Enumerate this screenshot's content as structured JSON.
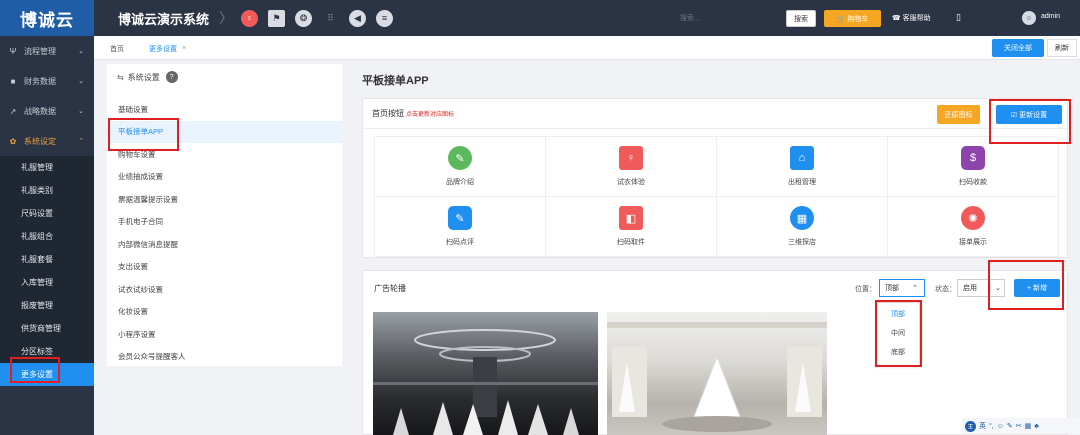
{
  "logo": "博诚云",
  "header": {
    "title": "博诚云演示系统",
    "search_placeholder": "搜索...",
    "search_button": "搜索",
    "cart_button": "购物车",
    "help": "客服帮助",
    "username": "admin"
  },
  "sidebar": {
    "items": [
      {
        "label": "流程管理",
        "icon": "flow-icon"
      },
      {
        "label": "财务数据",
        "icon": "briefcase-icon"
      },
      {
        "label": "战略数据",
        "icon": "trend-icon"
      },
      {
        "label": "系统设定",
        "icon": "gear-icon"
      }
    ],
    "subitems": [
      "礼服管理",
      "礼服类别",
      "尺码设置",
      "礼服组合",
      "礼服套餐",
      "入库管理",
      "报废管理",
      "供货商管理",
      "分区标签",
      "更多设置"
    ]
  },
  "tabs": {
    "home": "首页",
    "more": "更多设置",
    "close_all": "关闭全部",
    "refresh": "刷新"
  },
  "settings": {
    "title": "系统设置",
    "items": [
      "基础设置",
      "平板接单APP",
      "购物车设置",
      "业绩抽成设置",
      "票据温馨提示设置",
      "手机电子合同",
      "内部微信消息提醒",
      "支出设置",
      "试衣试纱设置",
      "化妆设置",
      "小程序设置",
      "会员公众号提醒客人"
    ]
  },
  "main": {
    "title": "平板接单APP",
    "home_buttons": {
      "title": "首页按钮",
      "hint": "点击更新对应图标",
      "restore": "还原图标",
      "update": "更新设置",
      "items": [
        {
          "label": "品牌介绍",
          "color": "#5cb85c",
          "icon": "tag-icon"
        },
        {
          "label": "试衣体验",
          "color": "#f05a5a",
          "icon": "dress-icon"
        },
        {
          "label": "出租管理",
          "color": "#1f8ff0",
          "icon": "shop-icon"
        },
        {
          "label": "扫码收款",
          "color": "#8e44ad",
          "icon": "money-icon"
        },
        {
          "label": "扫码点评",
          "color": "#1f8ff0",
          "icon": "edit-icon"
        },
        {
          "label": "扫码取件",
          "color": "#f05a5a",
          "icon": "bag-icon"
        },
        {
          "label": "三维探店",
          "color": "#1f8ff0",
          "icon": "store-icon"
        },
        {
          "label": "接单展示",
          "color": "#f05a5a",
          "icon": "team-icon"
        }
      ]
    },
    "ads": {
      "title": "广告轮播",
      "position_label": "位置：",
      "position_value": "顶部",
      "status_label": "状态：",
      "status_value": "启用",
      "add": "+ 新增",
      "position_options": [
        "顶部",
        "中间",
        "底部"
      ]
    }
  },
  "ime": {
    "lang": "英"
  }
}
